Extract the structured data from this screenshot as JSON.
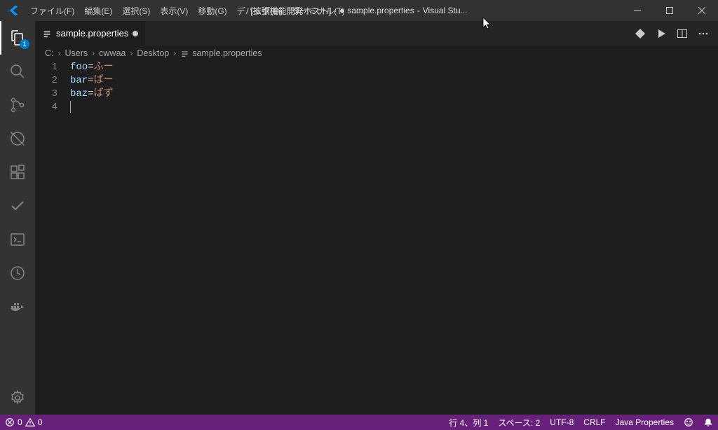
{
  "title": {
    "prefix": "[拡張機能開発ホスト]",
    "dirty_marker": "●",
    "filename": "sample.properties",
    "app": "Visual Stu..."
  },
  "menu": {
    "file": "ファイル(F)",
    "edit": "編集(E)",
    "selection": "選択(S)",
    "view": "表示(V)",
    "go": "移動(G)",
    "debug": "デバッグ(D)",
    "terminal": "ターミナル(T)",
    "more": "…"
  },
  "activity": {
    "explorer_badge": "1"
  },
  "tab": {
    "name": "sample.properties"
  },
  "breadcrumbs": {
    "c": "C:",
    "users": "Users",
    "user": "cwwaa",
    "desktop": "Desktop",
    "file": "sample.properties"
  },
  "editor": {
    "lines": [
      {
        "n": "1",
        "key": "foo",
        "eq": "=",
        "val": "ふー"
      },
      {
        "n": "2",
        "key": "bar",
        "eq": "=",
        "val": "ばー"
      },
      {
        "n": "3",
        "key": "baz",
        "eq": "=",
        "val": "ばず"
      },
      {
        "n": "4",
        "key": "",
        "eq": "",
        "val": ""
      }
    ]
  },
  "status": {
    "errors": "0",
    "warnings": "0",
    "ln_col": "行 4、列 1",
    "spaces": "スペース: 2",
    "encoding": "UTF-8",
    "eol": "CRLF",
    "language": "Java Properties"
  }
}
